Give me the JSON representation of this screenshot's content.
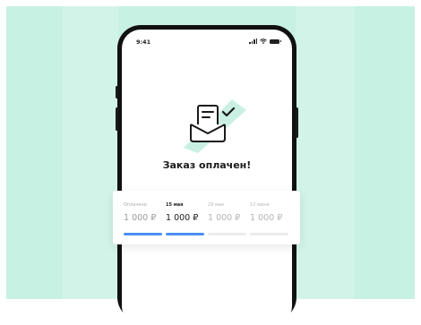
{
  "status_bar": {
    "time": "9:41"
  },
  "order": {
    "title": "Заказ оплачен!"
  },
  "payments": [
    {
      "date": "Оплачено",
      "amount": "1 000 ₽",
      "state": "paid"
    },
    {
      "date": "15 мая",
      "amount": "1 000 ₽",
      "state": "current"
    },
    {
      "date": "29 мая",
      "amount": "1 000 ₽",
      "state": "upcoming"
    },
    {
      "date": "12 июня",
      "amount": "1 000 ₽",
      "state": "upcoming"
    }
  ],
  "colors": {
    "background": "#c7f1e2",
    "accent": "#4a8ff5",
    "check_ribbon": "#c9f0e3"
  },
  "icons": {
    "illustration": "envelope-check-icon",
    "signal": "signal-icon",
    "wifi": "wifi-icon",
    "battery": "battery-icon"
  }
}
